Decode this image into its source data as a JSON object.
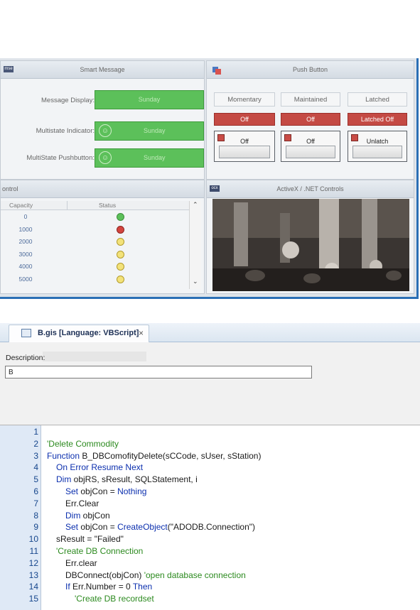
{
  "hmi": {
    "smart_message": {
      "title": "Smart Message",
      "icon": "mse",
      "rows": [
        {
          "label": "Message Display:",
          "value": "Sunday"
        },
        {
          "label": "Multistate Indicator:",
          "value": "Sunday"
        },
        {
          "label": "MultiState Pushbutton:",
          "value": "Sunday"
        }
      ]
    },
    "push_button": {
      "title": "Push Button",
      "columns": [
        "Momentary",
        "Maintained",
        "Latched"
      ],
      "red_buttons": [
        "Off",
        "Off",
        "Latched Off"
      ],
      "square_buttons": [
        "Off",
        "Off",
        "Unlatch"
      ]
    },
    "control": {
      "title": "ontrol",
      "headers": [
        "Capacity",
        "Status"
      ],
      "rows": [
        {
          "capacity": "0",
          "status": "green"
        },
        {
          "capacity": "1000",
          "status": "red"
        },
        {
          "capacity": "2000",
          "status": "yellow"
        },
        {
          "capacity": "3000",
          "status": "yellow"
        },
        {
          "capacity": "4000",
          "status": "yellow"
        },
        {
          "capacity": "5000",
          "status": "yellow"
        }
      ]
    },
    "activex": {
      "title": "ActiveX / .NET Controls",
      "icon": "ocx"
    }
  },
  "editor": {
    "tab_title": "B.gis [Language: VBScript]",
    "tab_close": "×",
    "description_label": "Description:",
    "description_value": "B",
    "lines": [
      {
        "n": "1",
        "indent": 0,
        "text": "",
        "kind": "plain"
      },
      {
        "n": "2",
        "indent": 0,
        "text": "'Delete Commodity",
        "kind": "comment"
      },
      {
        "n": "3",
        "indent": 0,
        "text": "Function B_DBComofityDelete(sCCode, sUser, sStation)",
        "kind": "mixed"
      },
      {
        "n": "4",
        "indent": 1,
        "text": "On Error Resume Next",
        "kind": "keyword"
      },
      {
        "n": "5",
        "indent": 1,
        "text": "Dim objRS, sResult, SQLStatement, i",
        "kind": "mixed"
      },
      {
        "n": "6",
        "indent": 2,
        "text": "Set objCon = Nothing",
        "kind": "mixed"
      },
      {
        "n": "7",
        "indent": 2,
        "text": "Err.Clear",
        "kind": "plain"
      },
      {
        "n": "8",
        "indent": 2,
        "text": "Dim objCon",
        "kind": "mixed"
      },
      {
        "n": "9",
        "indent": 2,
        "text": "Set objCon = CreateObject(\"ADODB.Connection\")",
        "kind": "mixed"
      },
      {
        "n": "10",
        "indent": 1,
        "text": "sResult = \"Failed\"",
        "kind": "plain"
      },
      {
        "n": "11",
        "indent": 1,
        "text": "'Create DB Connection",
        "kind": "comment"
      },
      {
        "n": "12",
        "indent": 2,
        "text": "Err.clear",
        "kind": "plain"
      },
      {
        "n": "13",
        "indent": 2,
        "text": "DBConnect(objCon) 'open database connection",
        "kind": "mixed"
      },
      {
        "n": "14",
        "indent": 2,
        "text": "If Err.Number = 0 Then",
        "kind": "mixed"
      },
      {
        "n": "15",
        "indent": 3,
        "text": "'Create DB recordset",
        "kind": "comment"
      }
    ]
  },
  "colors": {
    "accent_border": "#2b6fb5",
    "green_status": "#5cc05a",
    "red_button": "#c44a44",
    "keyword": "#0b2fae",
    "comment": "#2c8a1f"
  }
}
